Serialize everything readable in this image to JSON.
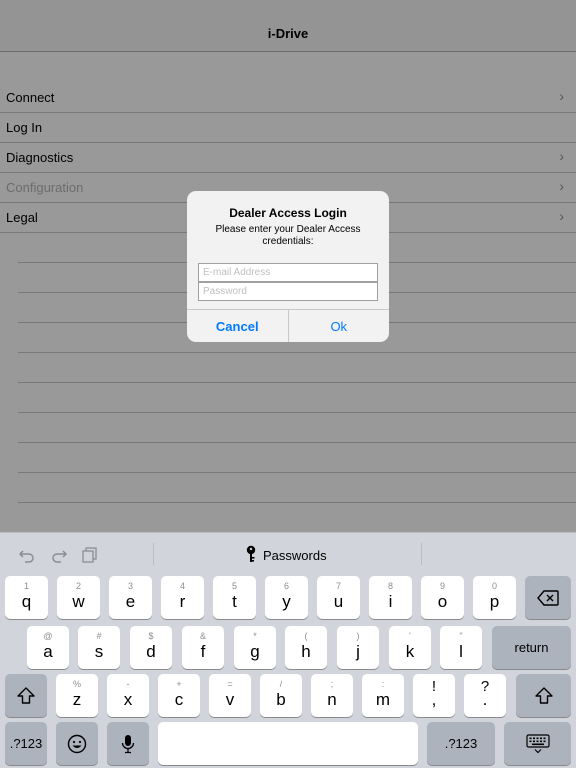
{
  "app": {
    "title": "i-Drive",
    "menu": [
      {
        "label": "Connect",
        "chevron": true,
        "disabled": false
      },
      {
        "label": "Log In",
        "chevron": false,
        "disabled": false
      },
      {
        "label": "Diagnostics",
        "chevron": true,
        "disabled": false
      },
      {
        "label": "Configuration",
        "chevron": true,
        "disabled": true
      },
      {
        "label": "Legal",
        "chevron": true,
        "disabled": false
      }
    ]
  },
  "alert": {
    "title": "Dealer Access Login",
    "message": "Please enter your Dealer Access credentials:",
    "email_placeholder": "E-mail Address",
    "password_placeholder": "Password",
    "cancel_label": "Cancel",
    "ok_label": "Ok"
  },
  "keyboard": {
    "toolbar": {
      "passwords_label": "Passwords"
    },
    "row1": [
      {
        "main": "q",
        "sub": "1"
      },
      {
        "main": "w",
        "sub": "2"
      },
      {
        "main": "e",
        "sub": "3"
      },
      {
        "main": "r",
        "sub": "4"
      },
      {
        "main": "t",
        "sub": "5"
      },
      {
        "main": "y",
        "sub": "6"
      },
      {
        "main": "u",
        "sub": "7"
      },
      {
        "main": "i",
        "sub": "8"
      },
      {
        "main": "o",
        "sub": "9"
      },
      {
        "main": "p",
        "sub": "0"
      }
    ],
    "row2": [
      {
        "main": "a",
        "sub": "@"
      },
      {
        "main": "s",
        "sub": "#"
      },
      {
        "main": "d",
        "sub": "$"
      },
      {
        "main": "f",
        "sub": "&"
      },
      {
        "main": "g",
        "sub": "*"
      },
      {
        "main": "h",
        "sub": "("
      },
      {
        "main": "j",
        "sub": ")"
      },
      {
        "main": "k",
        "sub": "'"
      },
      {
        "main": "l",
        "sub": "\""
      }
    ],
    "row3": [
      {
        "main": "z",
        "sub": "%"
      },
      {
        "main": "x",
        "sub": "-"
      },
      {
        "main": "c",
        "sub": "+"
      },
      {
        "main": "v",
        "sub": "="
      },
      {
        "main": "b",
        "sub": "/"
      },
      {
        "main": "n",
        "sub": ";"
      },
      {
        "main": "m",
        "sub": ":"
      },
      {
        "main": ",",
        "sub": "!"
      },
      {
        "main": ".",
        "sub": "?"
      }
    ],
    "return_label": "return",
    "numbers_label": ".?123",
    "space_label": ""
  }
}
